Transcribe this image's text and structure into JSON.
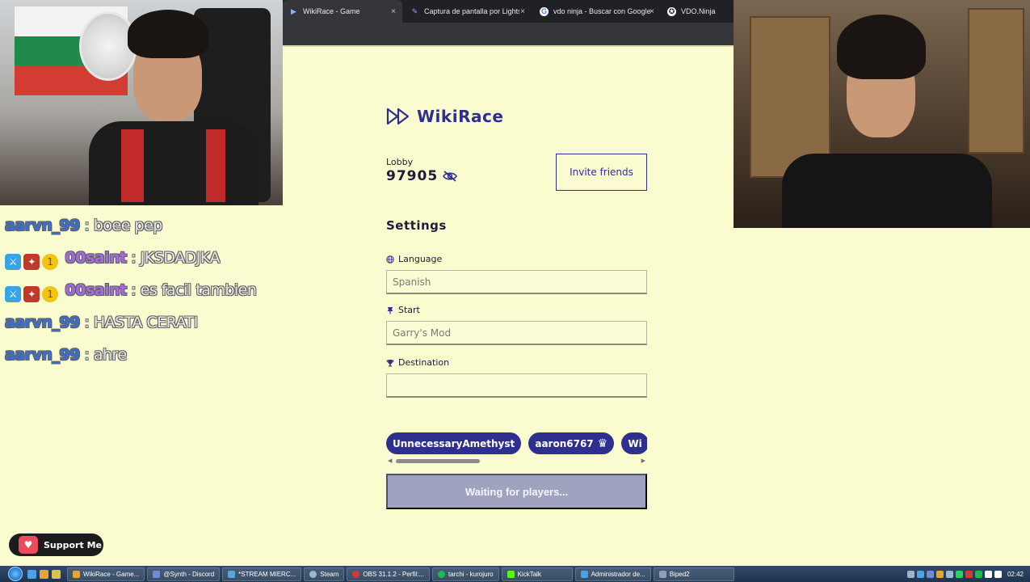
{
  "browser": {
    "tabs": [
      {
        "label": "WikiRace - Game",
        "icon": "wikirace-icon",
        "active": true
      },
      {
        "label": "Captura de pantalla por Lightsh",
        "icon": "feather-icon",
        "active": false
      },
      {
        "label": "vdo ninja - Buscar con Google",
        "icon": "google-icon",
        "active": false
      },
      {
        "label": "VDO.Ninja",
        "icon": "vdo-ninja-icon",
        "active": false
      }
    ],
    "close_symbol": "×"
  },
  "app": {
    "logo_text": "WikiRace",
    "lobby": {
      "label": "Lobby",
      "code": "97905"
    },
    "invite_label": "Invite friends",
    "settings_title": "Settings",
    "fields": {
      "language": {
        "label": "Language",
        "value": "Spanish"
      },
      "start": {
        "label": "Start",
        "value": "Garry's Mod"
      },
      "destination": {
        "label": "Destination",
        "value": ""
      }
    },
    "players": [
      {
        "name": "UnnecessaryAmethyst",
        "crown": false
      },
      {
        "name": "aaron6767",
        "crown": true
      },
      {
        "name": "Wi",
        "crown": false
      }
    ],
    "crown_symbol": "♛",
    "waiting_label": "Waiting for players..."
  },
  "chat": {
    "messages": [
      {
        "user": "aarvn_99",
        "text": "boee pep",
        "color": "#3b6fcf",
        "badges": false
      },
      {
        "user": "00saint",
        "text": "JKSDADJKA",
        "color": "#a46be0",
        "badges": true
      },
      {
        "user": "00saint",
        "text": "es facil tambien",
        "color": "#a46be0",
        "badges": true
      },
      {
        "user": "aarvn_99",
        "text": "HASTA CERATI",
        "color": "#3b6fcf",
        "badges": false
      },
      {
        "user": "aarvn_99",
        "text": "ahre",
        "color": "#3b6fcf",
        "badges": false
      }
    ],
    "separator": " : "
  },
  "support": {
    "label": "Support Me"
  },
  "taskbar": {
    "items": [
      {
        "label": "WikiRace - Game...",
        "color": "#e8a23a"
      },
      {
        "label": "@Synth - Discord",
        "color": "#7289da"
      },
      {
        "label": "*STREAM MIERC...",
        "color": "#5aa6d8"
      },
      {
        "label": "Steam",
        "color": "#9bb8d3"
      },
      {
        "label": "OBS 31.1.2 - Perfil:...",
        "color": "#d23a3a"
      },
      {
        "label": "tarchi - kurojuro",
        "color": "#1db954"
      },
      {
        "label": "KickTalk",
        "color": "#53fc18"
      },
      {
        "label": "Administrador de...",
        "color": "#4aa3e8"
      },
      {
        "label": "Biped2",
        "color": "#8f9fb8"
      }
    ],
    "clock": "02:42"
  },
  "colors": {
    "accent": "#2e2f8f",
    "page_bg": "#fafbcf",
    "waiting_bg": "#9fa3c0"
  }
}
